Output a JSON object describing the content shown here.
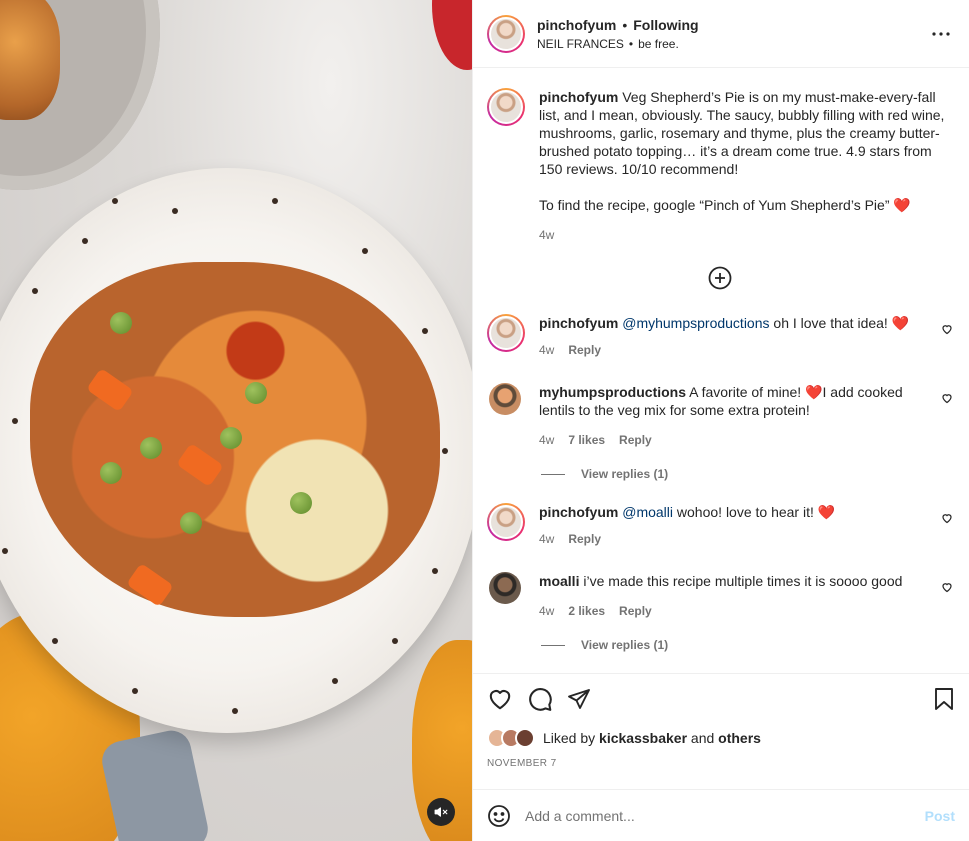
{
  "header": {
    "username": "pinchofyum",
    "separator": "•",
    "follow_label": "Following",
    "audio_artist": "NEIL FRANCES",
    "audio_separator": "•",
    "audio_title": "be free."
  },
  "caption": {
    "username": "pinchofyum",
    "text_p1": "Veg Shepherd’s Pie is on my must-make-every-fall list, and I mean, obviously. The saucy, bubbly filling with red wine, mushrooms, garlic, rosemary and thyme, plus the creamy butter-brushed potato topping… it’s a dream come true. 4.9 stars from 150 reviews. 10/10 recommend!",
    "text_p2": "To find the recipe, google “Pinch of Yum Shepherd’s Pie” ❤️",
    "time": "4w"
  },
  "comments": [
    {
      "username": "pinchofyum",
      "mention": "@myhumpsproductions",
      "text": " oh I love that idea! ❤️",
      "time": "4w",
      "likes": "",
      "reply_label": "Reply"
    },
    {
      "username": "myhumpsproductions",
      "mention": "",
      "text": " A favorite of mine! ❤️I add cooked lentils to the veg mix for some extra protein!",
      "time": "4w",
      "likes": "7 likes",
      "reply_label": "Reply",
      "view_replies": "View replies (1)"
    },
    {
      "username": "pinchofyum",
      "mention": "@moalli",
      "text": " wohoo! love to hear it! ❤️",
      "time": "4w",
      "likes": "",
      "reply_label": "Reply"
    },
    {
      "username": "moalli",
      "mention": "",
      "text": " i’ve made this recipe multiple times it is soooo good",
      "time": "4w",
      "likes": "2 likes",
      "reply_label": "Reply",
      "view_replies": "View replies (1)"
    }
  ],
  "likes": {
    "prefix": "Liked by",
    "user": "kickassbaker",
    "and": "and",
    "others": "others"
  },
  "date": "NOVEMBER 7",
  "add_comment": {
    "placeholder": "Add a comment...",
    "post_label": "Post"
  },
  "icons": {
    "more": "more-horizontal-icon",
    "load_more": "plus-circle-icon",
    "like": "heart-icon",
    "comment": "comment-icon",
    "share": "paper-plane-icon",
    "save": "bookmark-icon",
    "emoji": "emoji-icon",
    "mute": "speaker-muted-icon"
  },
  "colors": {
    "text": "#262626",
    "secondary": "#737373",
    "link": "#00376b",
    "post_button_disabled": "#b2dffc",
    "border": "#efefef"
  }
}
